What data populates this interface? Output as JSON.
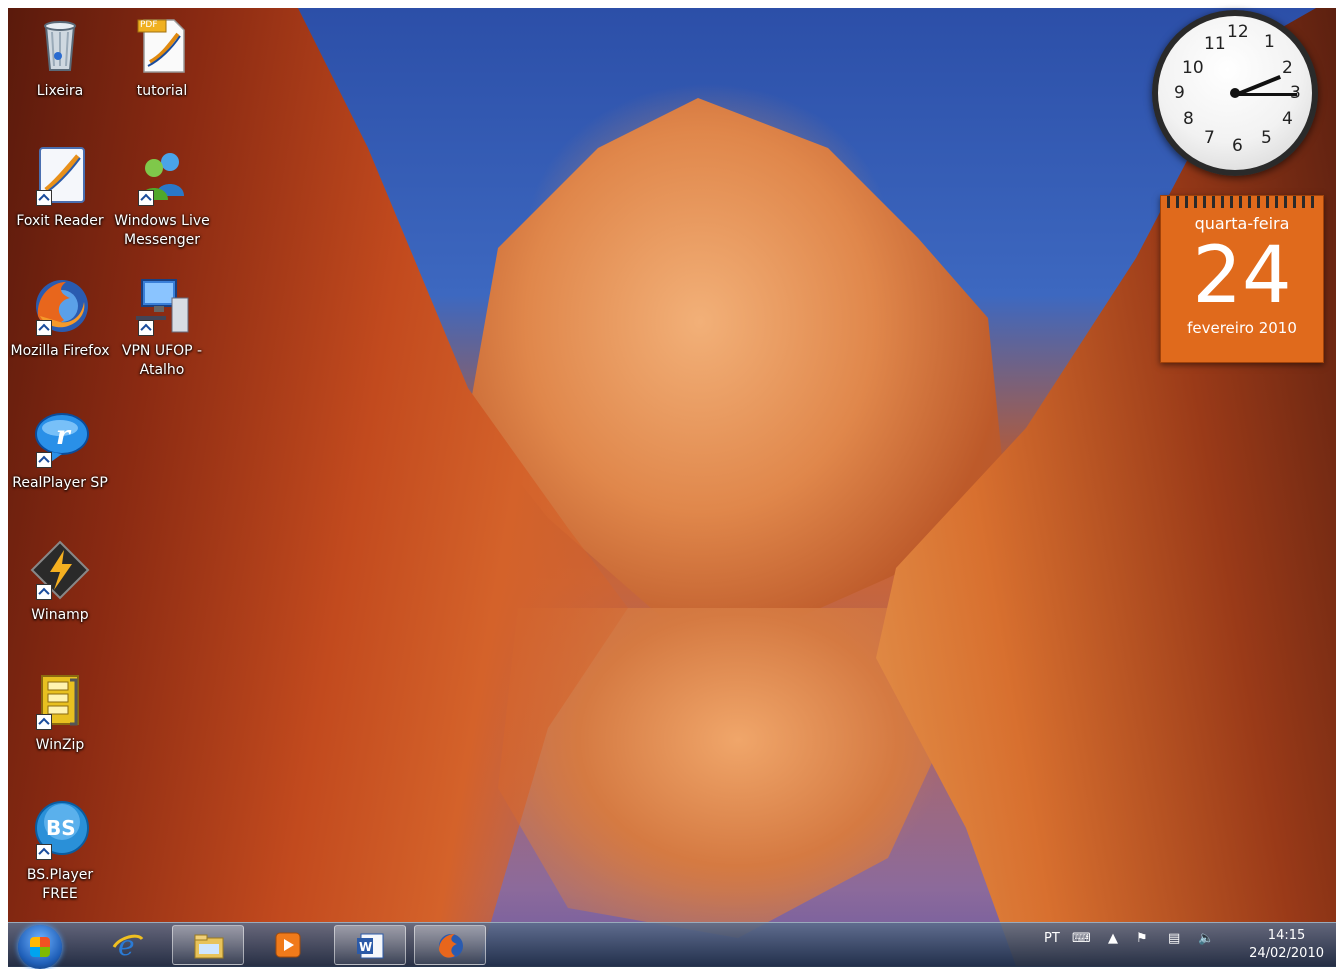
{
  "desktop": {
    "icons": [
      {
        "label": "Lixeira"
      },
      {
        "label": "tutorial",
        "badge": "PDF"
      },
      {
        "label": "Foxit Reader"
      },
      {
        "label": "Windows Live Messenger"
      },
      {
        "label": "Mozilla Firefox"
      },
      {
        "label": "VPN UFOP - Atalho"
      },
      {
        "label": "RealPlayer SP"
      },
      {
        "label": "Winamp"
      },
      {
        "label": "WinZip"
      },
      {
        "label": "BS.Player FREE",
        "badge": "BS"
      }
    ]
  },
  "gadgets": {
    "clock": {
      "numbers": [
        "12",
        "1",
        "2",
        "3",
        "4",
        "5",
        "6",
        "7",
        "8",
        "9",
        "10",
        "11"
      ],
      "time": "14:15"
    },
    "calendar": {
      "weekday": "quarta-feira",
      "day": "24",
      "month_year": "fevereiro 2010"
    }
  },
  "taskbar": {
    "language": "PT",
    "time": "14:15",
    "date": "24/02/2010",
    "pinned": [
      {
        "name": "Internet Explorer",
        "icon": "ie-icon",
        "color": "#2a7bd6"
      },
      {
        "name": "Windows Explorer",
        "icon": "folder-icon",
        "color": "#e8c35a"
      },
      {
        "name": "Windows Media Player",
        "icon": "media-player-icon",
        "color": "#f07a1a"
      },
      {
        "name": "Microsoft Word",
        "icon": "word-icon",
        "color": "#2b5aa8"
      },
      {
        "name": "Mozilla Firefox",
        "icon": "firefox-icon",
        "color": "#e8661c"
      }
    ]
  }
}
